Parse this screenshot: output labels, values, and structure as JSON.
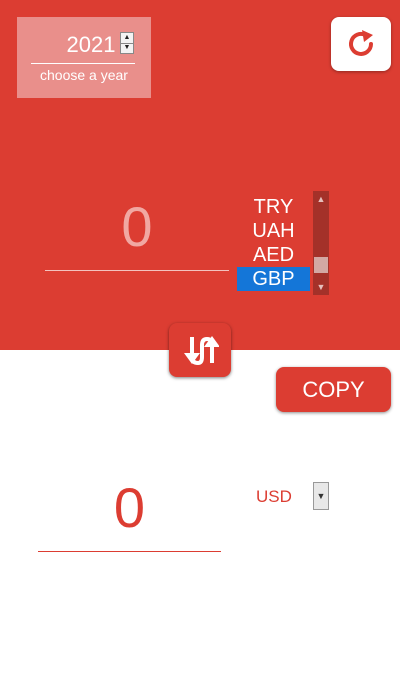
{
  "year": {
    "value": "2021",
    "hint": "choose a year",
    "spin_up_glyph": "▲",
    "spin_down_glyph": "▼"
  },
  "from": {
    "amount": "0",
    "currencies": [
      "TRY",
      "UAH",
      "AED",
      "GBP"
    ],
    "selected_currency": "GBP",
    "scroll_up_glyph": "▲",
    "scroll_down_glyph": "▼"
  },
  "buttons": {
    "refresh_icon": "refresh-icon",
    "swap_icon": "swap-arrows-icon",
    "copy_label": "COPY"
  },
  "to": {
    "amount": "0",
    "currency": "USD",
    "dropdown_glyph": "▼"
  },
  "colors": {
    "accent": "#dc3d32",
    "selected": "#1476d8"
  }
}
